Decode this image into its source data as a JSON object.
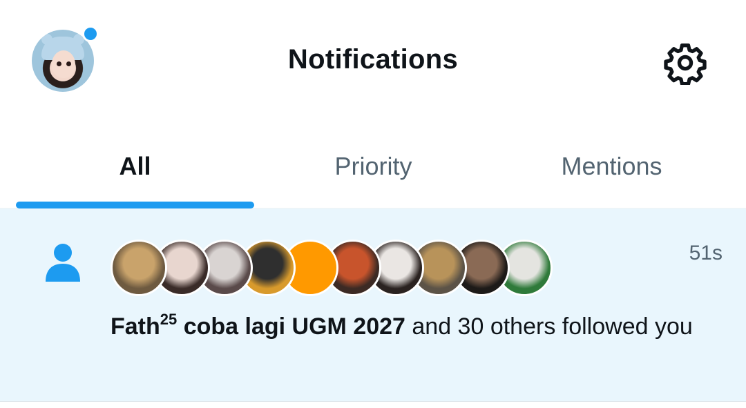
{
  "header": {
    "title": "Notifications",
    "profile_avatar": "profile-avatar",
    "has_unread_badge": true,
    "settings_icon": "gear-icon"
  },
  "tabs": [
    {
      "label": "All",
      "active": true
    },
    {
      "label": "Priority",
      "active": false
    },
    {
      "label": "Mentions",
      "active": false
    }
  ],
  "notification": {
    "icon": "person-icon",
    "timestamp": "51s",
    "actor_name": "Fath",
    "actor_superscript": "25",
    "actor_name_rest": " coba lagi UGM 2027",
    "message": " and 30 others followed you",
    "avatars": [
      {
        "name": "cat-avatar",
        "colors": [
          "#c9a36b",
          "#6e5a40"
        ]
      },
      {
        "name": "girl-avatar",
        "colors": [
          "#e8d6cf",
          "#3a2b28"
        ]
      },
      {
        "name": "hand-photo-avatar",
        "colors": [
          "#d9d4d2",
          "#5a4a4a"
        ]
      },
      {
        "name": "plush-avatar",
        "colors": [
          "#2f2f2f",
          "#d89a2c"
        ]
      },
      {
        "name": "orange-avatar",
        "colors": [
          "#ff9900",
          "#ff9900"
        ]
      },
      {
        "name": "fire-avatar",
        "colors": [
          "#c8542c",
          "#3c2a24"
        ]
      },
      {
        "name": "woman-avatar",
        "colors": [
          "#eae6e3",
          "#2a2220"
        ]
      },
      {
        "name": "cat-car-avatar",
        "colors": [
          "#b8935a",
          "#5c5347"
        ]
      },
      {
        "name": "man-avatar",
        "colors": [
          "#8a6a55",
          "#1d1a18"
        ]
      },
      {
        "name": "frog-hat-cat-avatar",
        "colors": [
          "#e4e4e0",
          "#2f7a3a"
        ]
      }
    ]
  },
  "colors": {
    "accent": "#1d9bf0",
    "text_primary": "#0f1419",
    "text_secondary": "#536471",
    "unread_background": "#e9f6fd"
  }
}
